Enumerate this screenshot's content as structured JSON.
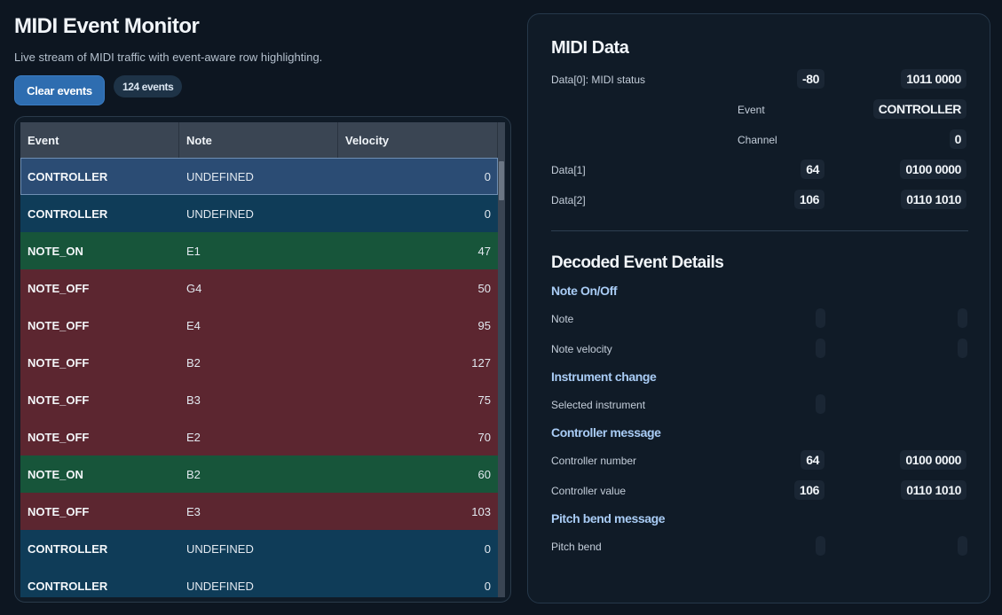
{
  "header": {
    "title": "MIDI Event Monitor",
    "subtitle": "Live stream of MIDI traffic with event-aware row highlighting.",
    "clear_label": "Clear events",
    "count_label": "124 events"
  },
  "table": {
    "columns": [
      "Event",
      "Note",
      "Velocity"
    ],
    "rows": [
      {
        "event": "CONTROLLER",
        "note": "UNDEFINED",
        "velocity": "0",
        "kind": "controller",
        "selected": true
      },
      {
        "event": "CONTROLLER",
        "note": "UNDEFINED",
        "velocity": "0",
        "kind": "controller"
      },
      {
        "event": "NOTE_ON",
        "note": "E1",
        "velocity": "47",
        "kind": "note_on"
      },
      {
        "event": "NOTE_OFF",
        "note": "G4",
        "velocity": "50",
        "kind": "note_off"
      },
      {
        "event": "NOTE_OFF",
        "note": "E4",
        "velocity": "95",
        "kind": "note_off"
      },
      {
        "event": "NOTE_OFF",
        "note": "B2",
        "velocity": "127",
        "kind": "note_off"
      },
      {
        "event": "NOTE_OFF",
        "note": "B3",
        "velocity": "75",
        "kind": "note_off"
      },
      {
        "event": "NOTE_OFF",
        "note": "E2",
        "velocity": "70",
        "kind": "note_off"
      },
      {
        "event": "NOTE_ON",
        "note": "B2",
        "velocity": "60",
        "kind": "note_on"
      },
      {
        "event": "NOTE_OFF",
        "note": "E3",
        "velocity": "103",
        "kind": "note_off"
      },
      {
        "event": "CONTROLLER",
        "note": "UNDEFINED",
        "velocity": "0",
        "kind": "controller"
      },
      {
        "event": "CONTROLLER",
        "note": "UNDEFINED",
        "velocity": "0",
        "kind": "controller"
      }
    ]
  },
  "midi_data": {
    "title": "MIDI Data",
    "status_label": "Data[0]: MIDI status",
    "status_dec": "-80",
    "status_bin": "1011 0000",
    "event_label": "Event",
    "event_value": "CONTROLLER",
    "channel_label": "Channel",
    "channel_value": "0",
    "data1_label": "Data[1]",
    "data1_dec": "64",
    "data1_bin": "0100 0000",
    "data2_label": "Data[2]",
    "data2_dec": "106",
    "data2_bin": "0110 1010"
  },
  "decoded": {
    "title": "Decoded Event Details",
    "note_section": "Note On/Off",
    "note_label": "Note",
    "velocity_label": "Note velocity",
    "instrument_section": "Instrument change",
    "instrument_label": "Selected instrument",
    "controller_section": "Controller message",
    "controller_number_label": "Controller number",
    "controller_number_dec": "64",
    "controller_number_bin": "0100 0000",
    "controller_value_label": "Controller value",
    "controller_value_dec": "106",
    "controller_value_bin": "0110 1010",
    "pitch_section": "Pitch bend message",
    "pitch_label": "Pitch bend"
  }
}
